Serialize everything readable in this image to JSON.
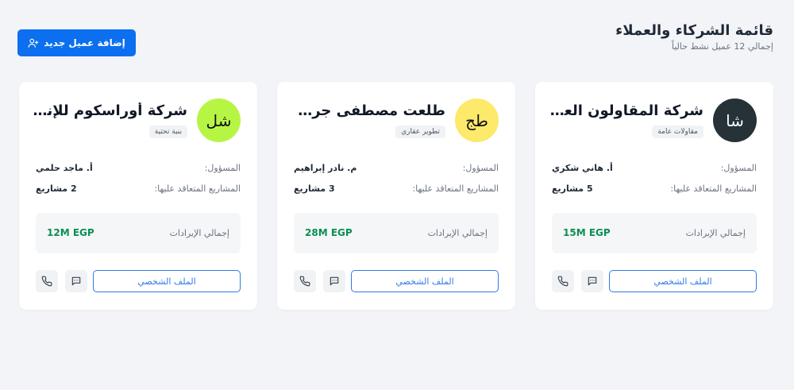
{
  "header": {
    "title": "قائمة الشركاء والعملاء",
    "subtitle": "إجمالي 12 عميل نشط حالياً",
    "add_button_label": "إضافة عميل جديد",
    "add_button_icon": "user-plus-icon"
  },
  "labels": {
    "manager": "المسؤول:",
    "projects": "المشاريع المتعاقد عليها:",
    "revenue": "إجمالي الإيرادات",
    "profile_button": "الملف الشخصي"
  },
  "partners": [
    {
      "initials": "شا",
      "name": "شركة المقاولون العرب",
      "category": "مقاولات عامة",
      "manager": "أ. هاني شكري",
      "projects": "5 مشاريع",
      "revenue": "15M EGP",
      "avatar_color": "#263238",
      "avatar_text_color": "#ffffff"
    },
    {
      "initials": "طج",
      "name": "طلعت مصطفى جروب",
      "category": "تطوير عقاري",
      "manager": "م. نادر إبراهيم",
      "projects": "3 مشاريع",
      "revenue": "28M EGP",
      "avatar_color": "#fde96a",
      "avatar_text_color": "#111111"
    },
    {
      "initials": "شل",
      "name": "شركة أوراسكوم للإنشاءات",
      "category": "بنية تحتية",
      "manager": "أ. ماجد حلمي",
      "projects": "2 مشاريع",
      "revenue": "12M EGP",
      "avatar_color": "#b7f545",
      "avatar_text_color": "#111111"
    }
  ],
  "colors": {
    "primary": "#0b6ff0",
    "revenue": "#0a8f4f",
    "page_background": "#f3f4f8"
  }
}
